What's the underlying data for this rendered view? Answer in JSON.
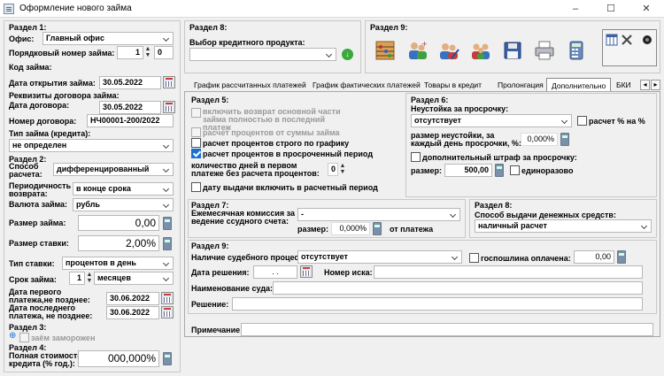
{
  "window": {
    "title": "Оформление нового займа",
    "minimize": "–",
    "maximize": "☐",
    "close": "✕"
  },
  "left": {
    "section1": "Раздел 1:",
    "office_label": "Офис:",
    "office_value": "Главный офис",
    "seq_label": "Порядковый номер займа:",
    "seq_value": "1",
    "seq_value2": "0",
    "code_label": "Код займа:",
    "open_date_label": "Дата открытия займа:",
    "open_date_value": "30.05.2022",
    "requisites_label": "Реквизиты договора займа:",
    "contract_date_label": "Дата договора:",
    "contract_date_value": "30.05.2022",
    "contract_no_label": "Номер договора:",
    "contract_no_value": "НЧ00001-200/2022",
    "loan_type_label": "Тип займа (кредита):",
    "loan_type_value": "не определен",
    "section2": "Раздел 2:",
    "calc_method_label": "Способ расчета:",
    "calc_method_value": "дифференцированный",
    "period_label": "Периодичность возврата:",
    "period_value": "в конце срока",
    "currency_label": "Валюта займа:",
    "currency_value": "рубль",
    "amount_label": "Размер займа:",
    "amount_value": "0,00",
    "rate_label": "Размер ставки:",
    "rate_value": "2,00%",
    "rate_type_label": "Тип ставки:",
    "rate_type_value": "процентов в день",
    "term_label": "Срок займа:",
    "term_value": "1",
    "term_unit": "месяцев",
    "first_pay_label": "Дата первого платежа,не позднее:",
    "first_pay_value": "30.06.2022",
    "last_pay_label": "Дата последнего платежа, не позднее:",
    "last_pay_value": "30.06.2022",
    "section3": "Раздел 3:",
    "frozen_label": "заём заморожен",
    "section4": "Раздел 4:",
    "full_cost_label": "Полная стоимость кредита (% год.):",
    "full_cost_value": "000,000%"
  },
  "top": {
    "section8": "Раздел 8:",
    "credit_product_label": "Выбор кредитного продукта:",
    "section9": "Раздел 9:"
  },
  "tabs": [
    {
      "label": "График рассчитанных платежей"
    },
    {
      "label": "График фактических платежей"
    },
    {
      "label": "Товары в кредит"
    },
    {
      "label": "Пролонгация"
    },
    {
      "label": "Дополнительно"
    },
    {
      "label": "БКИ"
    }
  ],
  "tab_nav": {
    "prev": "◂",
    "next": "▸"
  },
  "s5": {
    "title": "Раздел 5:",
    "opt1": "включить возврат основной части займа полностью в последний платеж",
    "opt2": "расчет процентов от суммы займа",
    "opt3": "расчет процентов строго по графику",
    "opt4": "расчет процентов в просроченный период",
    "days_label": "количество дней в первом платеже без расчета процентов:",
    "days_value": "0",
    "opt5": "дату выдачи включить в расчетный период"
  },
  "s6": {
    "title": "Раздел 6:",
    "penalty_label": "Неустойка за просрочку:",
    "penalty_value": "отсутствует",
    "pct_label": "расчет % на %",
    "rate_label": "размер неустойки, за каждый день просрочки, %:",
    "rate_value": "0,000%",
    "fine_label": "дополнительный штраф за просрочку:",
    "size_label": "размер:",
    "size_value": "500,00",
    "once_label": "единоразово"
  },
  "s7": {
    "title": "Раздел 7:",
    "commission_label": "Ежемесячная комиссия за ведение ссудного счета:",
    "commission_value": "-",
    "size_label": "размер:",
    "size_value": "0,000%",
    "from_label": "от платежа"
  },
  "s8b": {
    "title": "Раздел 8:",
    "method_label": "Способ выдачи денежных средств:",
    "method_value": "наличный расчет"
  },
  "s9": {
    "title": "Раздел 9:",
    "court_label": "Наличие судебного процесса:",
    "court_value": "отсутствует",
    "duty_label": "госпошлина оплачена:",
    "duty_value": "0,00",
    "decision_date_label": "Дата решения:",
    "decision_date_value": ". .",
    "claim_no_label": "Номер иска:",
    "court_name_label": "Наименование суда:",
    "decision_label": "Решение:",
    "note_label": "Примечание:"
  }
}
